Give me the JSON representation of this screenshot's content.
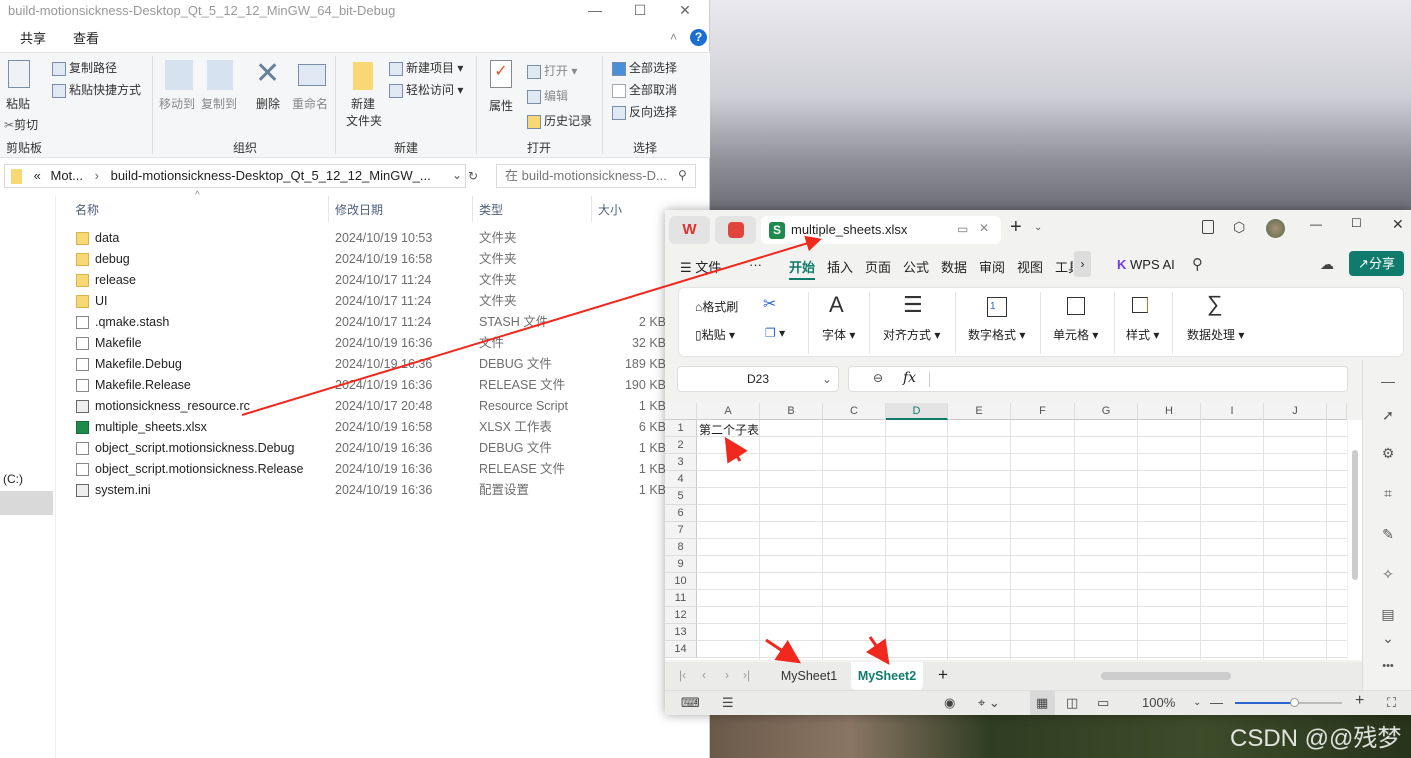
{
  "explorer": {
    "title": "build-motionsickness-Desktop_Qt_5_12_12_MinGW_64_bit-Debug",
    "tabs": [
      "共享",
      "查看"
    ],
    "ribbon": {
      "paste": "粘贴",
      "copy_path": "复制路径",
      "paste_shortcut": "粘贴快捷方式",
      "cut": "剪切",
      "move_to": "移动到",
      "copy_to": "复制到",
      "delete": "删除",
      "rename": "重命名",
      "new_folder_1": "新建",
      "new_folder_2": "文件夹",
      "new_item": "新建项目",
      "easy_access": "轻松访问",
      "properties": "属性",
      "open": "打开",
      "edit": "编辑",
      "history": "历史记录",
      "select_all": "全部选择",
      "select_none": "全部取消",
      "invert": "反向选择",
      "groups": [
        "剪贴板",
        "组织",
        "新建",
        "打开",
        "选择"
      ]
    },
    "address": {
      "prefix": "«",
      "crumb1": "Mot...",
      "crumb2": "build-motionsickness-Desktop_Qt_5_12_12_MinGW_..."
    },
    "search_placeholder": "在 build-motionsickness-D...",
    "columns": [
      "名称",
      "修改日期",
      "类型",
      "大小"
    ],
    "nav_drive": "(C:)",
    "files": [
      {
        "name": "data",
        "date": "2024/10/19 10:53",
        "type": "文件夹",
        "size": "",
        "icon": "folder"
      },
      {
        "name": "debug",
        "date": "2024/10/19 16:58",
        "type": "文件夹",
        "size": "",
        "icon": "folder"
      },
      {
        "name": "release",
        "date": "2024/10/17 11:24",
        "type": "文件夹",
        "size": "",
        "icon": "folder"
      },
      {
        "name": "UI",
        "date": "2024/10/17 11:24",
        "type": "文件夹",
        "size": "",
        "icon": "folder"
      },
      {
        "name": ".qmake.stash",
        "date": "2024/10/17 11:24",
        "type": "STASH 文件",
        "size": "2 KB",
        "icon": "doc"
      },
      {
        "name": "Makefile",
        "date": "2024/10/19 16:36",
        "type": "文件",
        "size": "32 KB",
        "icon": "doc"
      },
      {
        "name": "Makefile.Debug",
        "date": "2024/10/19 16:36",
        "type": "DEBUG 文件",
        "size": "189 KB",
        "icon": "doc"
      },
      {
        "name": "Makefile.Release",
        "date": "2024/10/19 16:36",
        "type": "RELEASE 文件",
        "size": "190 KB",
        "icon": "doc"
      },
      {
        "name": "motionsickness_resource.rc",
        "date": "2024/10/17 20:48",
        "type": "Resource Script",
        "size": "1 KB",
        "icon": "img"
      },
      {
        "name": "multiple_sheets.xlsx",
        "date": "2024/10/19 16:58",
        "type": "XLSX 工作表",
        "size": "6 KB",
        "icon": "xl"
      },
      {
        "name": "object_script.motionsickness.Debug",
        "date": "2024/10/19 16:36",
        "type": "DEBUG 文件",
        "size": "1 KB",
        "icon": "doc"
      },
      {
        "name": "object_script.motionsickness.Release",
        "date": "2024/10/19 16:36",
        "type": "RELEASE 文件",
        "size": "1 KB",
        "icon": "doc"
      },
      {
        "name": "system.ini",
        "date": "2024/10/19 16:36",
        "type": "配置设置",
        "size": "1 KB",
        "icon": "img"
      }
    ]
  },
  "wps": {
    "doc_tab": "multiple_sheets.xlsx",
    "menu": [
      "文件",
      "开始",
      "插入",
      "页面",
      "公式",
      "数据",
      "审阅",
      "视图",
      "工具"
    ],
    "menu_more": "···",
    "active_menu": "开始",
    "wps_ai": "WPS AI",
    "share": "分享",
    "ribbon": {
      "format_painter": "格式刷",
      "paste": "粘贴",
      "font": "字体",
      "align": "对齐方式",
      "number_format": "数字格式",
      "cell": "单元格",
      "style": "样式",
      "data_proc": "数据处理"
    },
    "name_box": "D23",
    "fx": "fx",
    "columns": [
      "A",
      "B",
      "C",
      "D",
      "E",
      "F",
      "G",
      "H",
      "I",
      "J"
    ],
    "rows": [
      "1",
      "2",
      "3",
      "4",
      "5",
      "6",
      "7",
      "8",
      "9",
      "10",
      "11",
      "12",
      "13",
      "14"
    ],
    "cell_A1": "第二个子表",
    "sheets": [
      "MySheet1",
      "MySheet2"
    ],
    "active_sheet": "MySheet2",
    "zoom": "100%",
    "zoom_fraction": 0.55,
    "accent": "#0f7b6c"
  },
  "watermark": "CSDN @@残梦"
}
